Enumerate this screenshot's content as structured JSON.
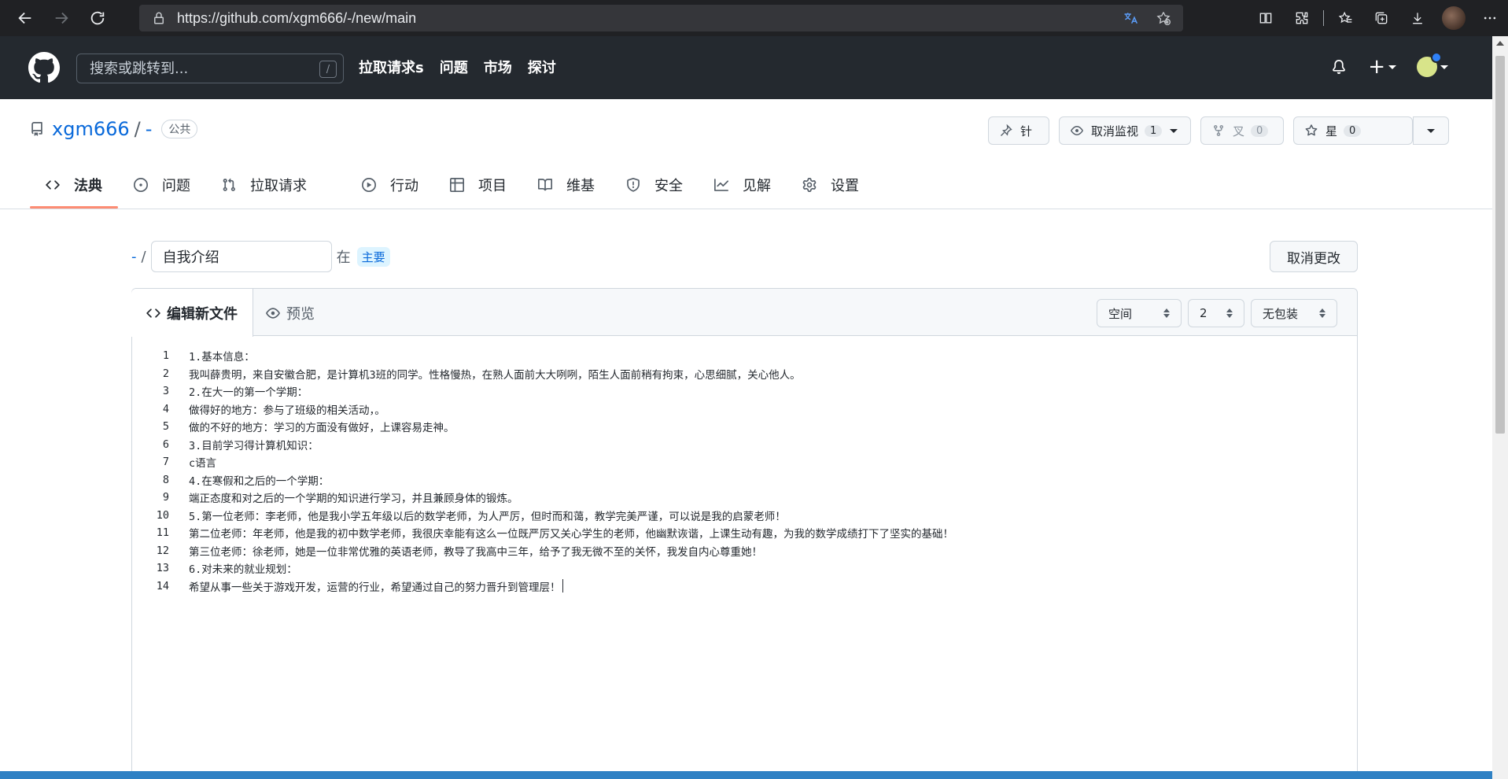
{
  "browser": {
    "url": "https://github.com/xgm666/-/new/main"
  },
  "header": {
    "search_placeholder": "搜索或跳转到...",
    "search_shortcut": "/",
    "nav": [
      "拉取请求s",
      "问题",
      "市场",
      "探讨"
    ]
  },
  "repo": {
    "owner": "xgm666",
    "separator": "/",
    "name": "-",
    "visibility": "公共",
    "pin_label": "针",
    "watch_label": "取消监视",
    "watch_count": "1",
    "fork_label": "叉",
    "fork_count": "0",
    "star_label": "星",
    "star_count": "0"
  },
  "tabs": [
    {
      "label": "法典",
      "icon": "code-icon",
      "active": true
    },
    {
      "label": "问题",
      "icon": "issue-icon"
    },
    {
      "label": "拉取请求",
      "icon": "pull-request-icon"
    },
    {
      "label": "行动",
      "icon": "play-icon"
    },
    {
      "label": "项目",
      "icon": "table-icon"
    },
    {
      "label": "维基",
      "icon": "book-icon"
    },
    {
      "label": "安全",
      "icon": "shield-icon"
    },
    {
      "label": "见解",
      "icon": "graph-icon"
    },
    {
      "label": "设置",
      "icon": "gear-icon"
    }
  ],
  "file": {
    "root": "-",
    "separator": "/",
    "name_value": "自我介绍",
    "in_text": "在",
    "branch": "主要",
    "cancel_label": "取消更改"
  },
  "editor": {
    "edit_tab": "编辑新文件",
    "preview_tab": "预览",
    "indent_mode": "空间",
    "indent_size": "2",
    "wrap_mode": "无包装",
    "lines": [
      "1.基本信息：",
      "我叫薛贵明，来自安徽合肥，是计算机3班的同学。性格慢热，在熟人面前大大咧咧，陌生人面前稍有拘束，心思细腻，关心他人。",
      "2.在大一的第一个学期：",
      "做得好的地方：参与了班级的相关活动，。",
      "做的不好的地方：学习的方面没有做好，上课容易走神。",
      "3.目前学习得计算机知识：",
      "c语言",
      "4.在寒假和之后的一个学期：",
      "端正态度和对之后的一个学期的知识进行学习，并且兼顾身体的锻炼。",
      "5.第一位老师：李老师，他是我小学五年级以后的数学老师，为人严厉，但时而和蔼，教学完美严谨，可以说是我的启蒙老师！",
      "第二位老师：年老师，他是我的初中数学老师，我很庆幸能有这么一位既严厉又关心学生的老师，他幽默诙谐，上课生动有趣，为我的数学成绩打下了坚实的基础！",
      "第三位老师：徐老师，她是一位非常优雅的英语老师，教导了我高中三年，给予了我无微不至的关怀，我发自内心尊重她！",
      "6.对未来的就业规划：",
      "希望从事一些关于游戏开发，运营的行业，希望通过自己的努力晋升到管理层！"
    ],
    "line_numbers": [
      "1",
      "2",
      "3",
      "4",
      "5",
      "6",
      "7",
      "8",
      "9",
      "10",
      "11",
      "12",
      "13",
      "14"
    ]
  }
}
